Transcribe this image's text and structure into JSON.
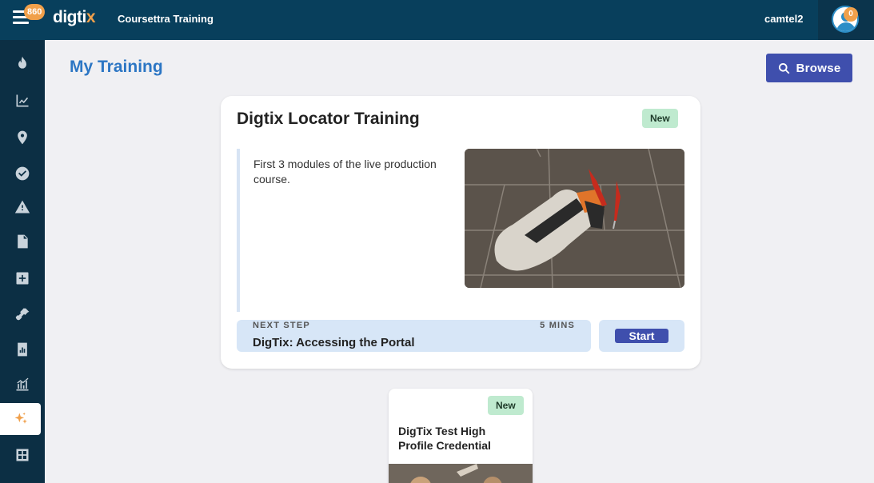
{
  "header": {
    "menu_badge": "860",
    "logo": {
      "main": "digti",
      "accent": "x"
    },
    "app_title": "Coursettra Training",
    "username": "camtel2",
    "avatar_badge": "0"
  },
  "sidebar": {
    "items": [
      {
        "name": "flame-icon"
      },
      {
        "name": "trend-chart-icon"
      },
      {
        "name": "map-pin-icon"
      },
      {
        "name": "check-circle-icon"
      },
      {
        "name": "warning-icon"
      },
      {
        "name": "document-icon"
      },
      {
        "name": "plus-square-icon"
      },
      {
        "name": "shovel-icon"
      },
      {
        "name": "report-icon"
      },
      {
        "name": "analytics-icon"
      },
      {
        "name": "sparkle-icon",
        "active": true
      },
      {
        "name": "grid-icon"
      }
    ]
  },
  "main": {
    "title": "My Training",
    "browse_label": "Browse",
    "featured": {
      "title": "Digtix Locator Training",
      "badge": "New",
      "description": "First 3 modules of the live production course.",
      "next_step_label": "NEXT STEP",
      "duration": "5 MINS",
      "next_step_title": "DigTix: Accessing the Portal",
      "start_label": "Start"
    },
    "secondary": {
      "badge": "New",
      "title": "DigTix Test High Profile Credential"
    }
  },
  "colors": {
    "topbar": "#083f5c",
    "sidebar": "#0c2f44",
    "accent": "#f0a04b",
    "primary_button": "#3f4fad",
    "title_blue": "#2c76c4",
    "badge_green": "#bfeacf"
  }
}
